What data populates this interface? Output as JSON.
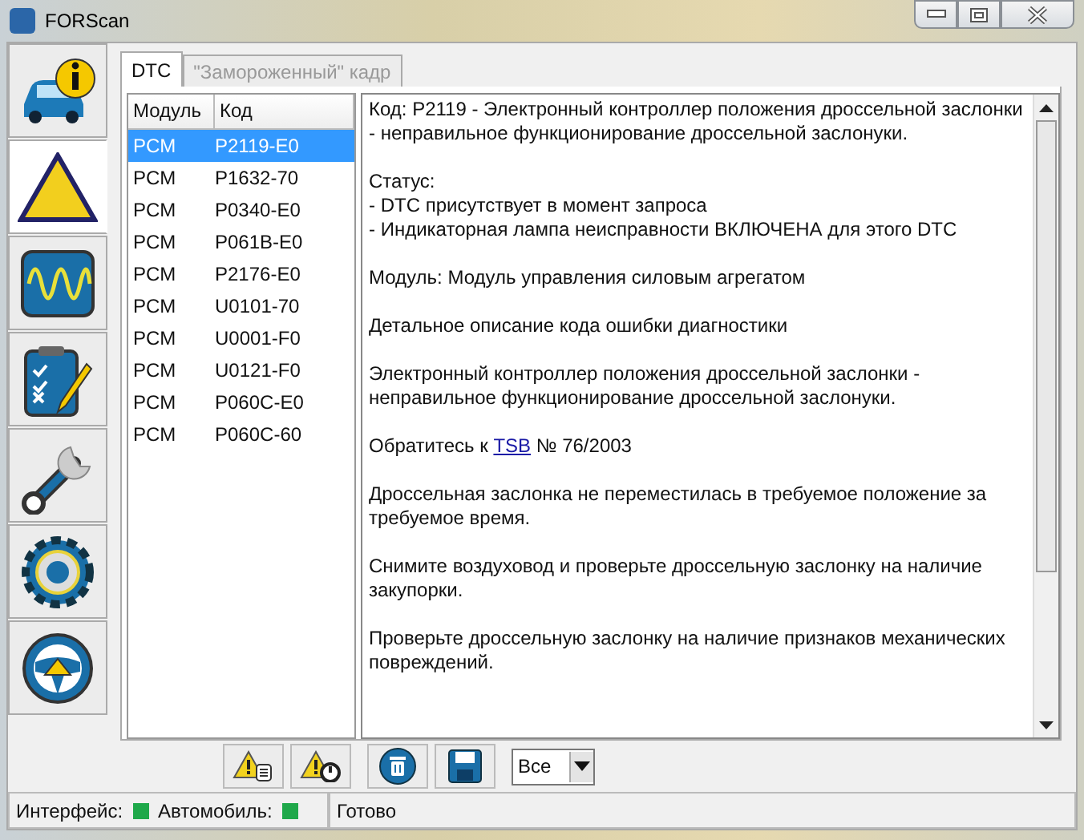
{
  "window": {
    "title": "FORScan"
  },
  "sidebar": {
    "items": [
      {
        "kind": "info",
        "selected": false
      },
      {
        "kind": "dtc",
        "selected": true
      },
      {
        "kind": "oscilloscope",
        "selected": false
      },
      {
        "kind": "checklist",
        "selected": false
      },
      {
        "kind": "wrench",
        "selected": false
      },
      {
        "kind": "gear",
        "selected": false
      },
      {
        "kind": "help",
        "selected": false
      }
    ]
  },
  "tabs": [
    {
      "label": "DTC",
      "selected": true
    },
    {
      "label": "\"Замороженный\" кадр",
      "selected": false
    }
  ],
  "table": {
    "columns": [
      "Модуль",
      "Код"
    ],
    "rows": [
      {
        "module": "PCM",
        "code": "P2119-E0",
        "selected": true
      },
      {
        "module": "PCM",
        "code": "P1632-70",
        "selected": false
      },
      {
        "module": "PCM",
        "code": "P0340-E0",
        "selected": false
      },
      {
        "module": "PCM",
        "code": "P061B-E0",
        "selected": false
      },
      {
        "module": "PCM",
        "code": "P2176-E0",
        "selected": false
      },
      {
        "module": "PCM",
        "code": "U0101-70",
        "selected": false
      },
      {
        "module": "PCM",
        "code": "U0001-F0",
        "selected": false
      },
      {
        "module": "PCM",
        "code": "U0121-F0",
        "selected": false
      },
      {
        "module": "PCM",
        "code": "P060C-E0",
        "selected": false
      },
      {
        "module": "PCM",
        "code": "P060C-60",
        "selected": false
      }
    ]
  },
  "details": {
    "paragraphs": [
      {
        "kind": "text",
        "lines": [
          "Код: P2119 - Электронный контроллер положения дроссельной заслонки - неправильное функционирование дроссельной заслонуки."
        ]
      },
      {
        "kind": "text",
        "lines": [
          "Статус:",
          " - DTC присутствует в момент запроса",
          " - Индикаторная лампа неисправности ВКЛЮЧЕНА для этого DTC"
        ]
      },
      {
        "kind": "text",
        "lines": [
          "Модуль: Модуль управления силовым агрегатом"
        ]
      },
      {
        "kind": "text",
        "lines": [
          "Детальное описание кода ошибки диагностики"
        ]
      },
      {
        "kind": "text",
        "lines": [
          "Электронный контроллер положения дроссельной заслонки - неправильное функционирование дроссельной заслонуки."
        ]
      },
      {
        "kind": "link",
        "before": "Обратитесь к",
        "link": "TSB",
        "after": "№ 76/2003"
      },
      {
        "kind": "text",
        "lines": [
          "Дроссельная заслонка не переместилась в требуемое положение за требуемое время."
        ]
      },
      {
        "kind": "text",
        "lines": [
          "Снимите воздуховод и проверьте дроссельную заслонку на наличие закупорки."
        ]
      },
      {
        "kind": "text",
        "lines": [
          "Проверьте дроссельную заслонку на наличие признаков механических повреждений."
        ]
      }
    ]
  },
  "toolbar": {
    "buttons": [
      {
        "kind": "warning-list"
      },
      {
        "kind": "warning-clock"
      },
      {
        "kind": "delete"
      },
      {
        "kind": "save"
      }
    ],
    "filter": {
      "value": "Все"
    }
  },
  "status_bar": {
    "indicators": [
      {
        "label": "Интерфейс:",
        "color": "#1fa84a"
      },
      {
        "label": "Автомобиль:",
        "color": "#1fa84a"
      }
    ],
    "message": "Готово"
  }
}
